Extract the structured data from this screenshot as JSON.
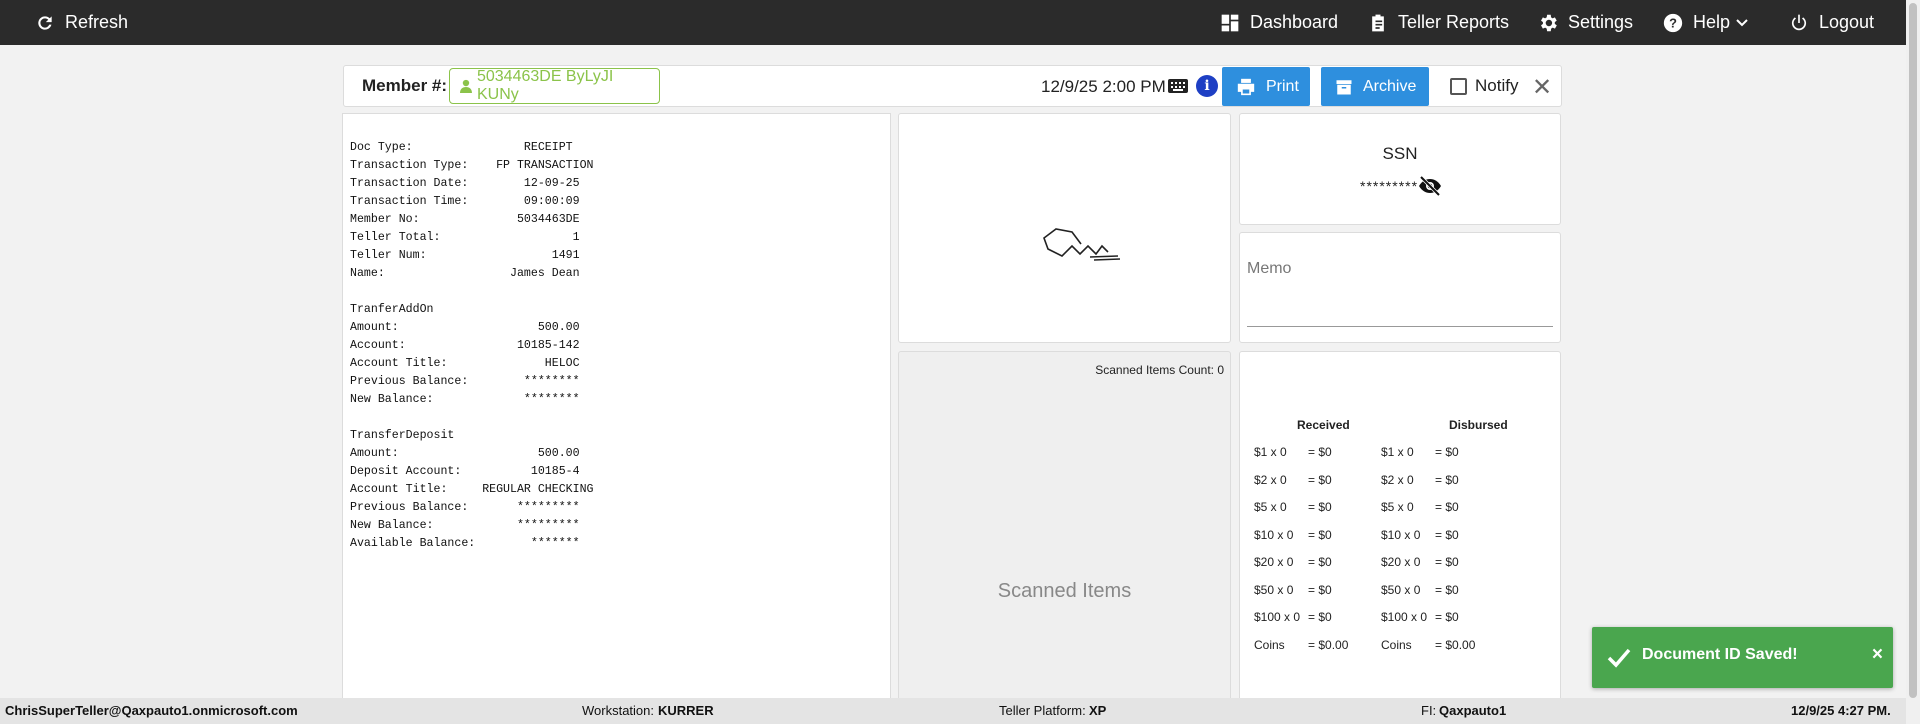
{
  "topbar": {
    "refresh": "Refresh",
    "dashboard": "Dashboard",
    "teller_reports": "Teller Reports",
    "settings": "Settings",
    "help": "Help",
    "logout": "Logout"
  },
  "header": {
    "member_label": "Member #:",
    "member_value": "5034463DE ByLyJI KUNy",
    "datetime": "12/9/25 2:00 PM",
    "print": "Print",
    "archive": "Archive",
    "notify": "Notify"
  },
  "receipt": {
    "lines": [
      "Doc Type:                RECEIPT",
      "Transaction Type:    FP TRANSACTION",
      "Transaction Date:        12-09-25",
      "Transaction Time:        09:00:09",
      "Member No:              5034463DE",
      "Teller Total:                   1",
      "Teller Num:                  1491",
      "Name:                  James Dean",
      "",
      "TranferAddOn",
      "Amount:                    500.00",
      "Account:                10185-142",
      "Account Title:              HELOC",
      "Previous Balance:        ********",
      "New Balance:             ********",
      "",
      "TransferDeposit",
      "Amount:                    500.00",
      "Deposit Account:          10185-4",
      "Account Title:     REGULAR CHECKING",
      "Previous Balance:       *********",
      "New Balance:            *********",
      "Available Balance:        *******"
    ]
  },
  "ssn": {
    "title": "SSN",
    "masked": "*********"
  },
  "memo": {
    "label": "Memo"
  },
  "scanned": {
    "count_label": "Scanned Items Count: 0",
    "placeholder": "Scanned Items"
  },
  "cash": {
    "received_header": "Received",
    "disbursed_header": "Disbursed",
    "received": [
      [
        "$1 x 0",
        "= $0"
      ],
      [
        "$2 x 0",
        "= $0"
      ],
      [
        "$5 x 0",
        "= $0"
      ],
      [
        "$10 x 0",
        "= $0"
      ],
      [
        "$20 x 0",
        "= $0"
      ],
      [
        "$50 x 0",
        "= $0"
      ],
      [
        "$100 x 0",
        "= $0"
      ],
      [
        "Coins",
        "= $0.00"
      ]
    ],
    "disbursed": [
      [
        "$1 x 0",
        "= $0"
      ],
      [
        "$2 x 0",
        "= $0"
      ],
      [
        "$5 x 0",
        "= $0"
      ],
      [
        "$10 x 0",
        "= $0"
      ],
      [
        "$20 x 0",
        "= $0"
      ],
      [
        "$50 x 0",
        "= $0"
      ],
      [
        "$100 x 0",
        "= $0"
      ],
      [
        "Coins",
        "= $0.00"
      ]
    ]
  },
  "statusbar": {
    "user": "ChrisSuperTeller@Qaxpauto1.onmicrosoft.com",
    "workstation_label": "Workstation:",
    "workstation": "KURRER",
    "platform_label": "Teller Platform:",
    "platform": "XP",
    "fi_label": "FI:",
    "fi": "Qaxpauto1",
    "datetime": "12/9/25 4:27 PM."
  },
  "toast": {
    "message": "Document ID Saved!",
    "close": "×"
  },
  "colors": {
    "topbar": "#2b2b2b",
    "primary_button": "#2e8fde",
    "member_chip": "#8bc34a",
    "toast": "#4aa64e"
  }
}
